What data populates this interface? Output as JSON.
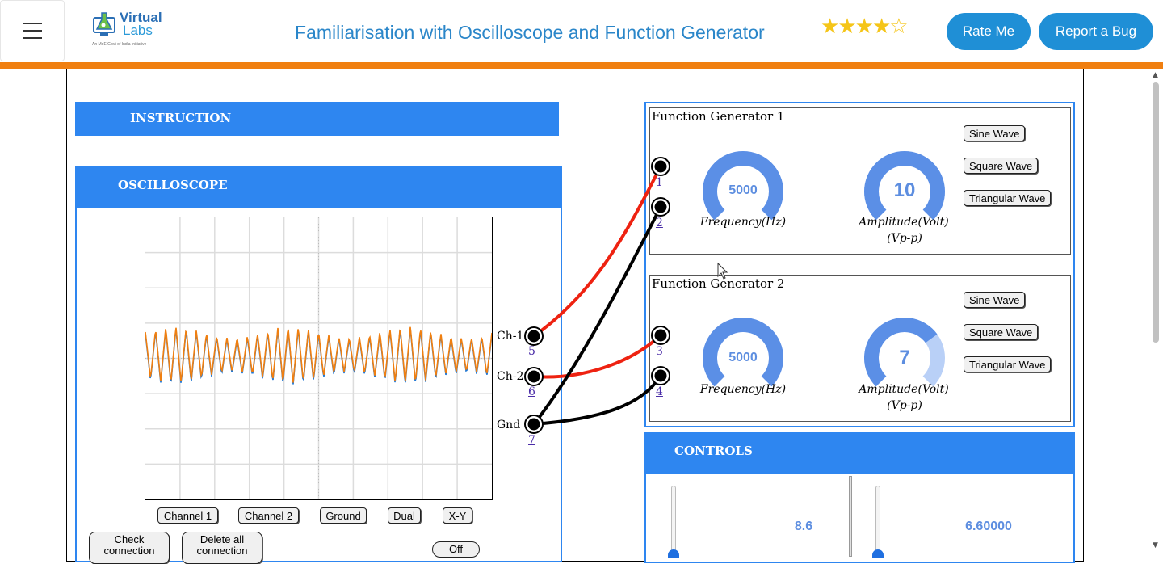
{
  "header": {
    "logo_line1": "Virtual",
    "logo_line2": "Labs",
    "logo_sub": "An MoE Govt of India Initiative",
    "title": "Familiarisation with Oscilloscope and Function Generator",
    "rating": {
      "filled": 4,
      "total": 5
    },
    "rate_label": "Rate Me",
    "bug_label": "Report a Bug",
    "accent": "#f07f10",
    "brand": "#1f8fd6"
  },
  "instruction": {
    "label": "INSTRUCTION"
  },
  "oscilloscope": {
    "label": "OSCILLOSCOPE",
    "buttons": [
      "Channel 1",
      "Channel 2",
      "Ground",
      "Dual",
      "X-Y"
    ],
    "check_label": "Check connection",
    "delete_label": "Delete all connection",
    "power_label": "Off",
    "terminals": [
      {
        "label": "Ch-1",
        "num": "5"
      },
      {
        "label": "Ch-2",
        "num": "6"
      },
      {
        "label": "Gnd",
        "num": "7"
      }
    ],
    "trace_colors": [
      "#f07f10",
      "#1f77d4"
    ]
  },
  "fg1": {
    "title": "Function Generator 1",
    "freq_value": "5000",
    "freq_label": "Frequency(Hz)",
    "amp_value": "10",
    "amp_label": "Amplitude(Volt)",
    "amp_unit": "(Vp-p)",
    "amp_fraction": 1.0,
    "terminals": [
      "1",
      "2"
    ],
    "waves": [
      "Sine Wave",
      "Square Wave",
      "Triangular Wave"
    ]
  },
  "fg2": {
    "title": "Function Generator 2",
    "freq_value": "5000",
    "freq_label": "Frequency(Hz)",
    "amp_value": "7",
    "amp_label": "Amplitude(Volt)",
    "amp_unit": "(Vp-p)",
    "amp_fraction": 0.7,
    "terminals": [
      "3",
      "4"
    ],
    "waves": [
      "Sine Wave",
      "Square Wave",
      "Triangular Wave"
    ]
  },
  "controls": {
    "label": "CONTROLS",
    "knob1_value": "8.6",
    "knob2_value": "6.60000",
    "knob2_fraction": 0.66
  }
}
